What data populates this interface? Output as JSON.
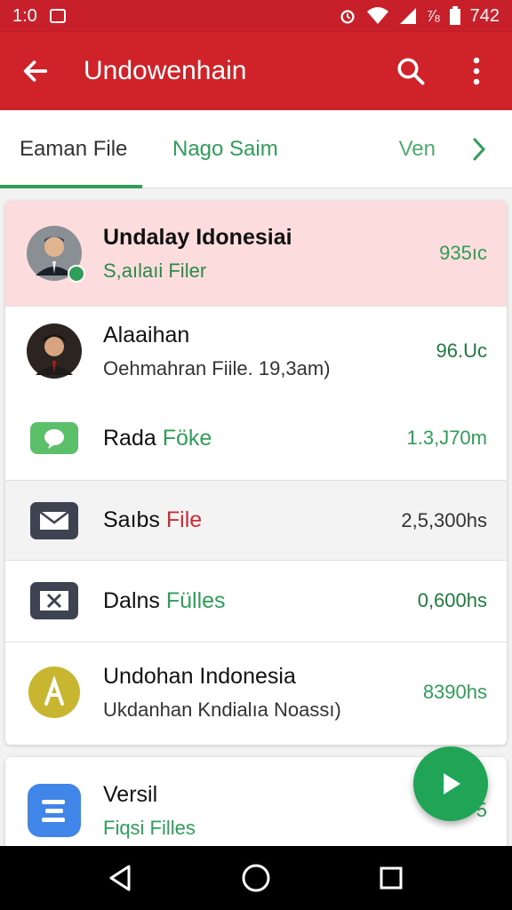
{
  "status_bar": {
    "time": "1:0",
    "battery": "742",
    "icons": [
      "image-icon",
      "alarm-icon",
      "wifi-icon",
      "signal-icon",
      "battery-icon"
    ]
  },
  "app_bar": {
    "title": "Undowenhain",
    "background": "#cf2229",
    "icons": [
      "back-arrow-icon",
      "search-icon",
      "more-vert-icon"
    ]
  },
  "tabs": {
    "items": [
      {
        "label": "Eaman File",
        "active": true
      },
      {
        "label": "Nago Saim",
        "active": false
      },
      {
        "label": "Ven",
        "active": false
      }
    ],
    "accent": "#2f9e58"
  },
  "list": {
    "items": [
      {
        "primary": "Undalay Idonesiai",
        "secondary": "S,aılaıi Filer",
        "meta": "935ıc",
        "highlight": true,
        "meta_color": "#2f9e58"
      },
      {
        "primary": "Alaaihan",
        "secondary": "Oehmahran Fiile.   19,3am)",
        "meta": "96.Uc",
        "meta_color": "#1e7a3e"
      },
      {
        "primary_a": "Rada ",
        "primary_b": "Föke",
        "meta": "1.3,J70m",
        "meta_color": "#2f9e58",
        "icon": "chat-bubble-icon"
      },
      {
        "primary_a": "Saıbs ",
        "primary_b": "File",
        "meta": "2,5,300hs",
        "meta_color": "#333333",
        "icon": "mail-icon"
      },
      {
        "primary_a": "Dalns ",
        "primary_b": "Fülles",
        "meta": "0,600hs",
        "meta_color": "#1e7a3e",
        "icon": "close-box-icon"
      },
      {
        "primary": "Undohan Indonesia",
        "secondary": "Ukdanhan Kndialıa Noassı)",
        "meta": "8390hs",
        "meta_color": "#2f9e58",
        "icon": "letter-a-icon"
      }
    ]
  },
  "second_card": {
    "primary": "Versil",
    "secondary": "Fiqsi Filles",
    "meta": "5"
  },
  "fab": {
    "icon": "play-icon",
    "color": "#20a456"
  },
  "nav_bar": {
    "icons": [
      "nav-back-icon",
      "nav-home-icon",
      "nav-recents-icon"
    ]
  }
}
